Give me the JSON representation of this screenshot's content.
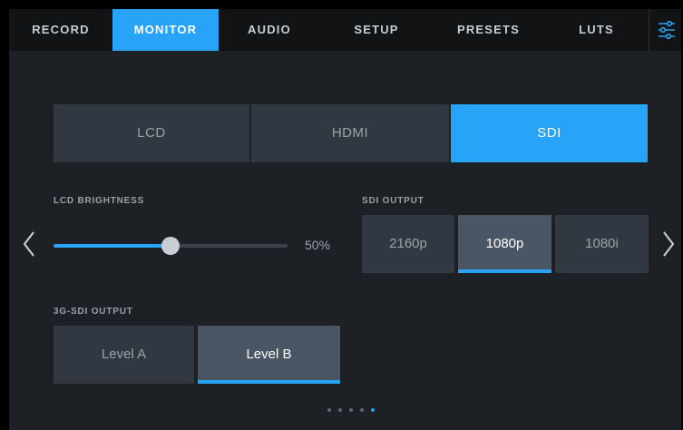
{
  "tabs": [
    {
      "label": "RECORD",
      "active": false
    },
    {
      "label": "MONITOR",
      "active": true
    },
    {
      "label": "AUDIO",
      "active": false
    },
    {
      "label": "SETUP",
      "active": false
    },
    {
      "label": "PRESETS",
      "active": false
    },
    {
      "label": "LUTS",
      "active": false
    }
  ],
  "menu_icon": "sliders-icon",
  "monitor_select": {
    "options": [
      "LCD",
      "HDMI",
      "SDI"
    ],
    "selected": "SDI"
  },
  "lcd_brightness": {
    "label": "LCD BRIGHTNESS",
    "value_percent": 50,
    "value_text": "50%"
  },
  "sdi_output": {
    "label": "SDI OUTPUT",
    "options": [
      "2160p",
      "1080p",
      "1080i"
    ],
    "selected": "1080p"
  },
  "sdi3g_output": {
    "label": "3G-SDI OUTPUT",
    "options": [
      "Level A",
      "Level B"
    ],
    "selected": "Level B"
  },
  "page_indicator": {
    "count": 5,
    "active_index": 4
  },
  "colors": {
    "accent": "#27a4f7",
    "panel": "#313841",
    "background": "#1d2126"
  }
}
